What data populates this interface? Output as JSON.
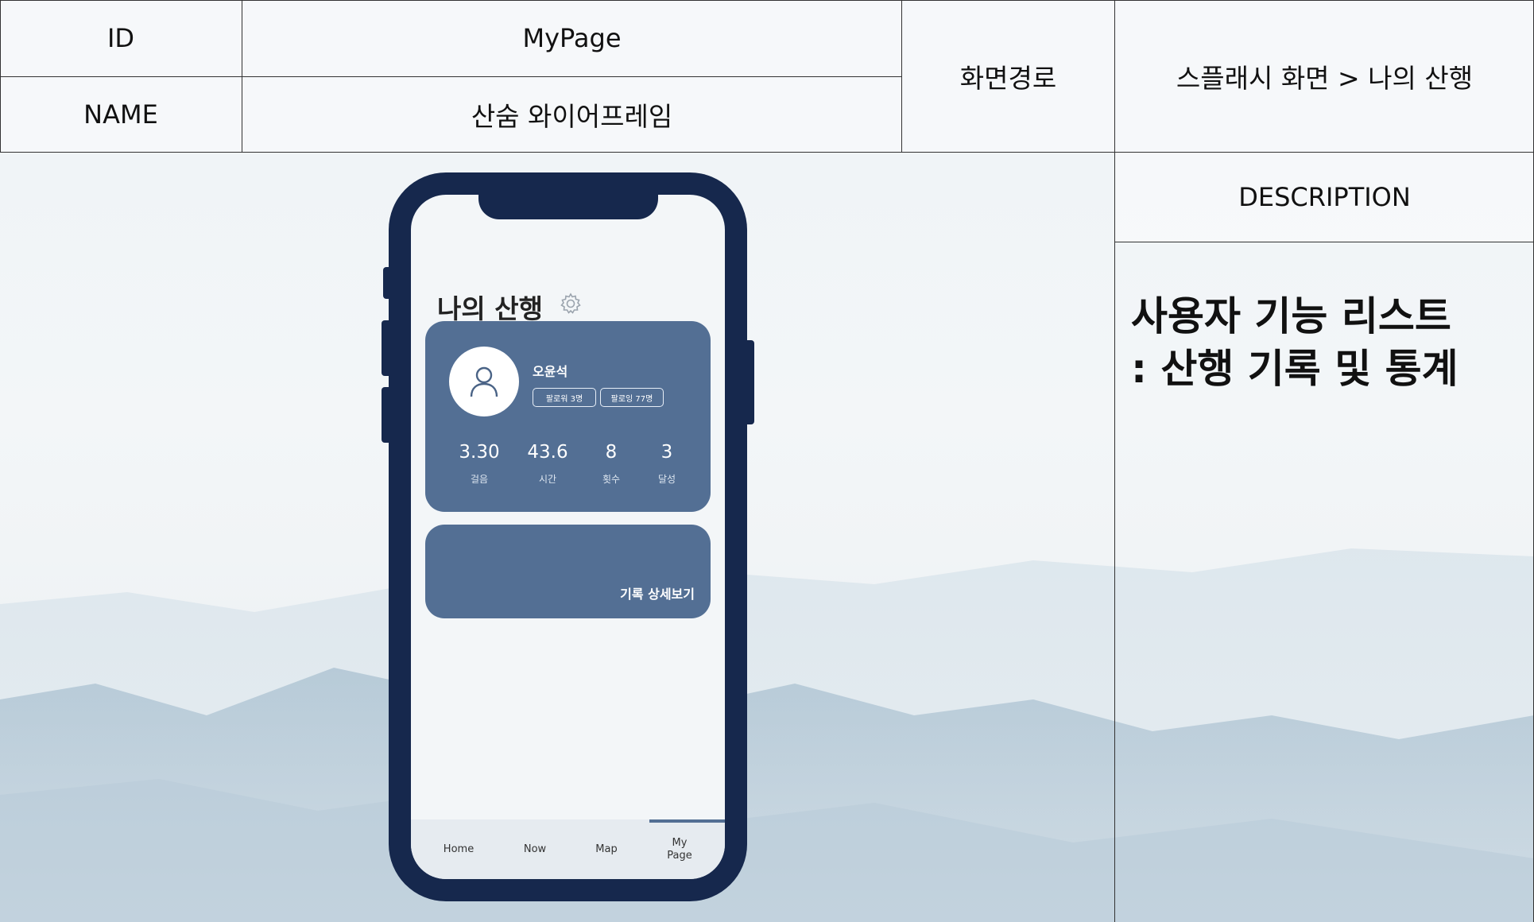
{
  "header": {
    "id_label": "ID",
    "id_value": "MyPage",
    "name_label": "NAME",
    "name_value": "산숨 와이어프레임",
    "path_label": "화면경로",
    "path_value": "스플래시 화면 > 나의 산행",
    "description_label": "DESCRIPTION"
  },
  "description": {
    "line1": "사용자 기능 리스트",
    "line2": ": 산행 기록 및 통계"
  },
  "phone": {
    "page_title": "나의 산행",
    "profile": {
      "name": "오윤석",
      "followers": "팔로워 3명",
      "following": "팔로잉 77명"
    },
    "stats": [
      {
        "value": "3.30",
        "label": "걸음"
      },
      {
        "value": "43.6",
        "label": "시간"
      },
      {
        "value": "8",
        "label": "횟수"
      },
      {
        "value": "3",
        "label": "달성"
      }
    ],
    "record_link": "기록 상세보기",
    "tabs": [
      {
        "label": "Home"
      },
      {
        "label": "Now"
      },
      {
        "label": "Map"
      },
      {
        "label": "My\nPage"
      }
    ],
    "active_tab": "My Page"
  },
  "colors": {
    "phone_frame": "#16284d",
    "card": "#536f94",
    "screen_bg": "#f3f6f8"
  },
  "icons": [
    "gear-icon",
    "user-avatar-icon"
  ]
}
